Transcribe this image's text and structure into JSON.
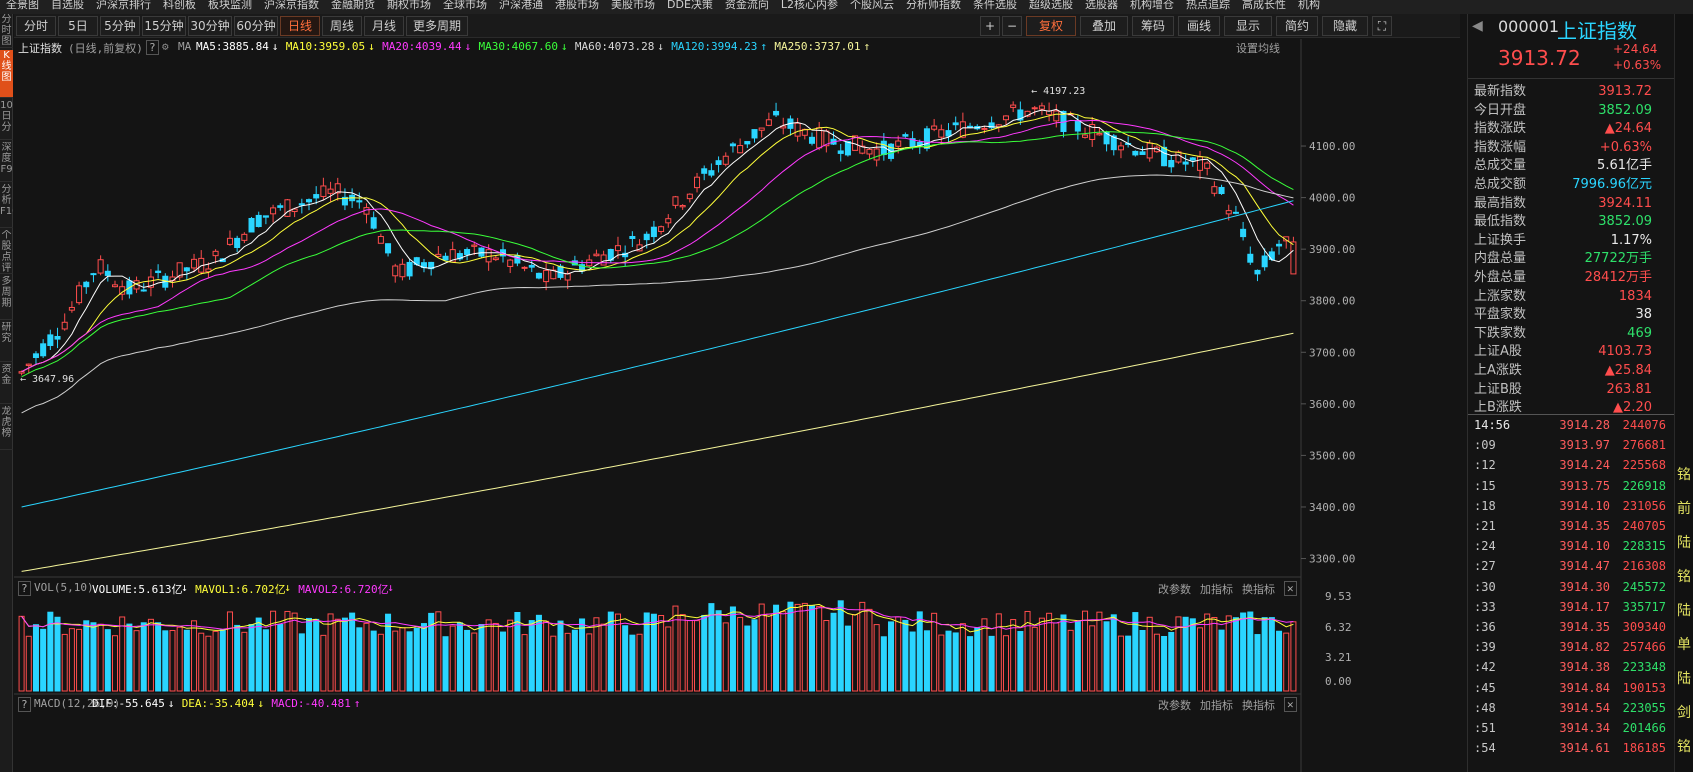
{
  "top_menu": [
    "全景图",
    "自选股",
    "沪深京排行",
    "科创板",
    "板块监测",
    "沪深京指数",
    "金融期货",
    "期权市场",
    "全球市场",
    "沪深港通",
    "港股市场",
    "美股市场",
    "DDE决策",
    "资金流向",
    "L2核心内参",
    "个股风云",
    "分析师指数",
    "条件选股",
    "超级选股",
    "选股器",
    "机构增仓",
    "热点追踪",
    "高成长性",
    "机构"
  ],
  "left_tabs": [
    "分时图",
    "K线图",
    "10日分",
    "深度F9",
    "分析F10",
    "个股点评",
    "多周期",
    "研究",
    "资金",
    "龙虎榜"
  ],
  "period_buttons": [
    "分时",
    "5日",
    "5分钟",
    "15分钟",
    "30分钟",
    "60分钟",
    "日线",
    "周线",
    "月线",
    "更多周期"
  ],
  "active_period": "日线",
  "toolbar": {
    "plus": "+",
    "minus": "−",
    "fuquan": "复权",
    "overlay": "叠加",
    "chips": "筹码",
    "draw": "画线",
    "display": "显示",
    "simple": "简约",
    "hide": "隐藏"
  },
  "ma_header": {
    "name": "上证指数",
    "subtitle": "(日线,前复权)",
    "ma_label": "MA",
    "items": [
      {
        "text": "MA5:3885.84",
        "arrow": "↓",
        "color": "#ffffff"
      },
      {
        "text": "MA10:3959.05",
        "arrow": "↓",
        "color": "#ffff3a"
      },
      {
        "text": "MA20:4039.44",
        "arrow": "↓",
        "color": "#ff3aff"
      },
      {
        "text": "MA30:4067.60",
        "arrow": "↓",
        "color": "#3aff3a"
      },
      {
        "text": "MA60:4073.28",
        "arrow": "↓",
        "color": "#d8d8d8"
      },
      {
        "text": "MA120:3994.23",
        "arrow": "↑",
        "color": "#2ad5ff"
      },
      {
        "text": "MA250:3737.01",
        "arrow": "↑",
        "color": "#f5f59a"
      }
    ],
    "settings": "设置均线"
  },
  "vol_header": {
    "label": "VOL(5,10)",
    "items": [
      {
        "text": "VOLUME:5.613亿",
        "arrow": "↓",
        "color": "#ffffff"
      },
      {
        "text": "MAVOL1:6.702亿",
        "arrow": "↓",
        "color": "#ffff3a"
      },
      {
        "text": "MAVOL2:6.720亿",
        "arrow": "↓",
        "color": "#ff3aff"
      }
    ],
    "actions": [
      "改参数",
      "加指标",
      "换指标"
    ]
  },
  "macd_header": {
    "label": "MACD(12,26,9)",
    "items": [
      {
        "text": "DIF:-55.645",
        "arrow": "↓",
        "color": "#ffffff"
      },
      {
        "text": "DEA:-35.404",
        "arrow": "↓",
        "color": "#ffff3a"
      },
      {
        "text": "MACD:-40.481",
        "arrow": "↑",
        "color": "#ff3aff"
      }
    ],
    "actions": [
      "改参数",
      "加指标",
      "换指标"
    ]
  },
  "annotations": {
    "high": "4197.23",
    "low": "3647.96"
  },
  "price_axis": [
    "4100.00",
    "4000.00",
    "3900.00",
    "3800.00",
    "3700.00",
    "3600.00",
    "3500.00",
    "3400.00",
    "3300.00"
  ],
  "vol_axis": [
    "9.53",
    "6.32",
    "3.21",
    "0.00"
  ],
  "quote": {
    "code": "000001",
    "name": "上证指数",
    "price": "3913.72",
    "change": "+24.64",
    "change_pct": "+0.63%",
    "rows": [
      {
        "label": "最新指数",
        "value": "3913.72",
        "cls": "up"
      },
      {
        "label": "今日开盘",
        "value": "3852.09",
        "cls": "dn"
      },
      {
        "label": "指数涨跌",
        "value": "▲24.64",
        "cls": "up"
      },
      {
        "label": "指数涨幅",
        "value": "+0.63%",
        "cls": "up"
      },
      {
        "label": "总成交量",
        "value": "5.61亿手",
        "cls": "wh"
      },
      {
        "label": "总成交额",
        "value": "7996.96亿元",
        "cls": "cy"
      },
      {
        "label": "最高指数",
        "value": "3924.11",
        "cls": "up"
      },
      {
        "label": "最低指数",
        "value": "3852.09",
        "cls": "dn"
      },
      {
        "label": "上证换手",
        "value": "1.17%",
        "cls": "wh"
      },
      {
        "label": "内盘总量",
        "value": "27722万手",
        "cls": "dn"
      },
      {
        "label": "外盘总量",
        "value": "28412万手",
        "cls": "up"
      },
      {
        "label": "上涨家数",
        "value": "1834",
        "cls": "up"
      },
      {
        "label": "平盘家数",
        "value": "38",
        "cls": "wh"
      },
      {
        "label": "下跌家数",
        "value": "469",
        "cls": "dn"
      },
      {
        "label": "上证A股",
        "value": "4103.73",
        "cls": "up"
      },
      {
        "label": "上A涨跌",
        "value": "▲25.84",
        "cls": "up"
      },
      {
        "label": "上证B股",
        "value": "263.81",
        "cls": "up"
      },
      {
        "label": "上B涨跌",
        "value": "▲2.20",
        "cls": "up"
      }
    ]
  },
  "ticks": [
    {
      "time": "14:56",
      "price": "3914.28",
      "vol": "244076",
      "cls": "up"
    },
    {
      "time": ":09",
      "price": "3913.97",
      "vol": "276681",
      "cls": "up"
    },
    {
      "time": ":12",
      "price": "3914.24",
      "vol": "225568",
      "cls": "up"
    },
    {
      "time": ":15",
      "price": "3913.75",
      "vol": "226918",
      "cls": "dn"
    },
    {
      "time": ":18",
      "price": "3914.10",
      "vol": "231056",
      "cls": "up"
    },
    {
      "time": ":21",
      "price": "3914.35",
      "vol": "240705",
      "cls": "up"
    },
    {
      "time": ":24",
      "price": "3914.10",
      "vol": "228315",
      "cls": "dn"
    },
    {
      "time": ":27",
      "price": "3914.47",
      "vol": "216308",
      "cls": "up"
    },
    {
      "time": ":30",
      "price": "3914.30",
      "vol": "245572",
      "cls": "dn"
    },
    {
      "time": ":33",
      "price": "3914.17",
      "vol": "335717",
      "cls": "dn"
    },
    {
      "time": ":36",
      "price": "3914.35",
      "vol": "309340",
      "cls": "up"
    },
    {
      "time": ":39",
      "price": "3914.82",
      "vol": "257466",
      "cls": "up"
    },
    {
      "time": ":42",
      "price": "3914.38",
      "vol": "223348",
      "cls": "dn"
    },
    {
      "time": ":45",
      "price": "3914.84",
      "vol": "190153",
      "cls": "up"
    },
    {
      "time": ":48",
      "price": "3914.54",
      "vol": "223055",
      "cls": "dn"
    },
    {
      "time": ":51",
      "price": "3914.34",
      "vol": "201466",
      "cls": "dn"
    },
    {
      "time": ":54",
      "price": "3914.61",
      "vol": "186185",
      "cls": "up"
    }
  ],
  "side_strip": [
    "铭",
    "前",
    "陆",
    "铭",
    "陆",
    "单",
    "陆",
    "剑",
    "铭"
  ]
}
